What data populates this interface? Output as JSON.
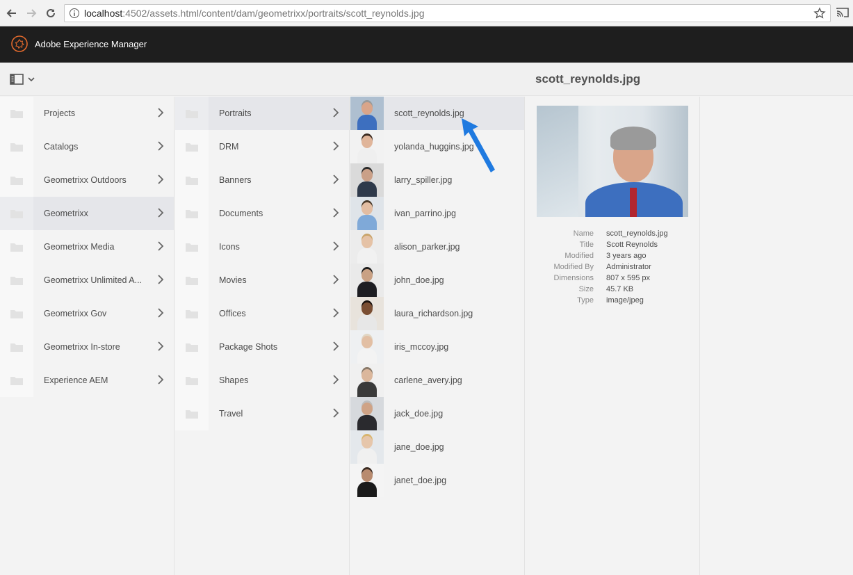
{
  "browser": {
    "url_host": "localhost",
    "url_path": ":4502/assets.html/content/dam/geometrixx/portraits/scott_reynolds.jpg"
  },
  "header": {
    "app_title": "Adobe Experience Manager"
  },
  "detail_title": "scott_reynolds.jpg",
  "column1": [
    {
      "label": "Projects"
    },
    {
      "label": "Catalogs"
    },
    {
      "label": "Geometrixx Outdoors"
    },
    {
      "label": "Geometrixx",
      "active": true
    },
    {
      "label": "Geometrixx Media"
    },
    {
      "label": "Geometrixx Unlimited A..."
    },
    {
      "label": "Geometrixx Gov"
    },
    {
      "label": "Geometrixx In-store"
    },
    {
      "label": "Experience AEM"
    }
  ],
  "column2": [
    {
      "label": "Portraits",
      "active": true
    },
    {
      "label": "DRM"
    },
    {
      "label": "Banners"
    },
    {
      "label": "Documents"
    },
    {
      "label": "Icons"
    },
    {
      "label": "Movies"
    },
    {
      "label": "Offices"
    },
    {
      "label": "Package Shots"
    },
    {
      "label": "Shapes"
    },
    {
      "label": "Travel"
    }
  ],
  "column3": [
    {
      "label": "scott_reynolds.jpg",
      "active": true
    },
    {
      "label": "yolanda_huggins.jpg"
    },
    {
      "label": "larry_spiller.jpg"
    },
    {
      "label": "ivan_parrino.jpg"
    },
    {
      "label": "alison_parker.jpg"
    },
    {
      "label": "john_doe.jpg"
    },
    {
      "label": "laura_richardson.jpg"
    },
    {
      "label": "iris_mccoy.jpg"
    },
    {
      "label": "carlene_avery.jpg"
    },
    {
      "label": "jack_doe.jpg"
    },
    {
      "label": "jane_doe.jpg"
    },
    {
      "label": "janet_doe.jpg"
    }
  ],
  "metadata": [
    {
      "key": "Name",
      "value": "scott_reynolds.jpg"
    },
    {
      "key": "Title",
      "value": "Scott Reynolds"
    },
    {
      "key": "Modified",
      "value": "3 years ago"
    },
    {
      "key": "Modified By",
      "value": "Administrator"
    },
    {
      "key": "Dimensions",
      "value": "807 x 595 px"
    },
    {
      "key": "Size",
      "value": "45.7 KB"
    },
    {
      "key": "Type",
      "value": "image/jpeg"
    }
  ],
  "colors": {
    "header_bg": "#1e1e1e",
    "active_row": "#e5e6ea",
    "accent_blue": "#1f7ae0"
  }
}
